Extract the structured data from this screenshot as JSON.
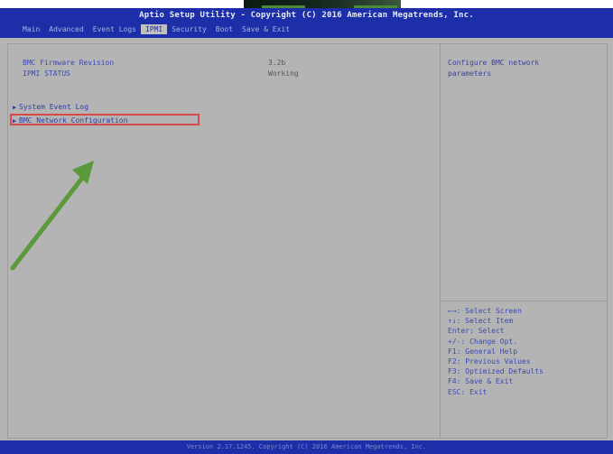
{
  "header": {
    "title": "Aptio Setup Utility - Copyright (C) 2016 American Megatrends, Inc.",
    "tabs": [
      "Main",
      "Advanced",
      "Event Logs",
      "IPMI",
      "Security",
      "Boot",
      "Save & Exit"
    ],
    "active_tab": "IPMI"
  },
  "main": {
    "info": [
      {
        "label": "BMC Firmware Revision",
        "value": "3.2b"
      },
      {
        "label": "IPMI STATUS",
        "value": "Working"
      }
    ],
    "menu": [
      {
        "label": "System Event Log"
      },
      {
        "label": "BMC Network Configuration"
      }
    ]
  },
  "help": {
    "description_line1": "Configure BMC network",
    "description_line2": "parameters",
    "keys": [
      "←→: Select Screen",
      "↑↓: Select Item",
      "Enter: Select",
      "+/-: Change Opt.",
      "F1: General Help",
      "F2: Previous Values",
      "F3: Optimized Defaults",
      "F4: Save & Exit",
      "ESC: Exit"
    ]
  },
  "footer": {
    "text": "Version 2.17.1245. Copyright (C) 2016 American Megatrends, Inc."
  },
  "colors": {
    "header_bg": "#1c2fa8",
    "body_bg": "#b4b4b4",
    "highlight_border": "#d84a4a",
    "arrow": "#5b9a3a"
  }
}
